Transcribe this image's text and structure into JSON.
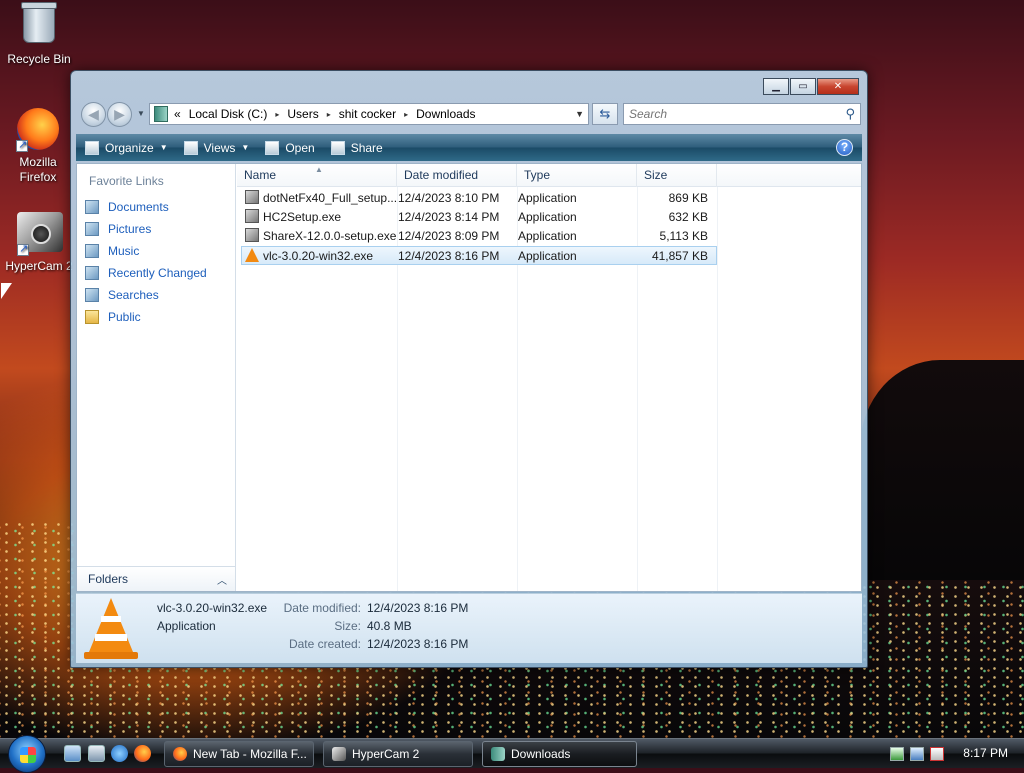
{
  "desktop": {
    "icons": [
      {
        "label": "Recycle Bin"
      },
      {
        "label": "Mozilla Firefox"
      },
      {
        "label": "HyperCam 2"
      }
    ]
  },
  "window": {
    "address": {
      "overflow": "«",
      "crumbs": [
        "Local Disk (C:)",
        "Users",
        "shit cocker",
        "Downloads"
      ],
      "separator": "▸"
    },
    "search": {
      "placeholder": "Search"
    },
    "toolbar": {
      "organize": "Organize",
      "views": "Views",
      "open": "Open",
      "share": "Share",
      "help": "?"
    },
    "favorites": {
      "title": "Favorite Links",
      "items": [
        "Documents",
        "Pictures",
        "Music",
        "Recently Changed",
        "Searches",
        "Public"
      ]
    },
    "folders_label": "Folders",
    "columns": [
      "Name",
      "Date modified",
      "Type",
      "Size"
    ],
    "files": [
      {
        "name": "dotNetFx40_Full_setup....",
        "date": "12/4/2023 8:10 PM",
        "type": "Application",
        "size": "869 KB"
      },
      {
        "name": "HC2Setup.exe",
        "date": "12/4/2023 8:14 PM",
        "type": "Application",
        "size": "632 KB"
      },
      {
        "name": "ShareX-12.0.0-setup.exe",
        "date": "12/4/2023 8:09 PM",
        "type": "Application",
        "size": "5,113 KB"
      },
      {
        "name": "vlc-3.0.20-win32.exe",
        "date": "12/4/2023 8:16 PM",
        "type": "Application",
        "size": "41,857 KB"
      }
    ],
    "details": {
      "name": "vlc-3.0.20-win32.exe",
      "type": "Application",
      "date_modified_label": "Date modified:",
      "date_modified": "12/4/2023 8:16 PM",
      "size_label": "Size:",
      "size": "40.8 MB",
      "date_created_label": "Date created:",
      "date_created": "12/4/2023 8:16 PM"
    }
  },
  "taskbar": {
    "tasks": [
      "New Tab - Mozilla F...",
      "HyperCam 2",
      "Downloads"
    ],
    "clock": "8:17 PM"
  },
  "colors": {
    "accent": "#1e5fbc",
    "toolbar": "#2f5e7c",
    "vlc_orange": "#f38a10"
  }
}
